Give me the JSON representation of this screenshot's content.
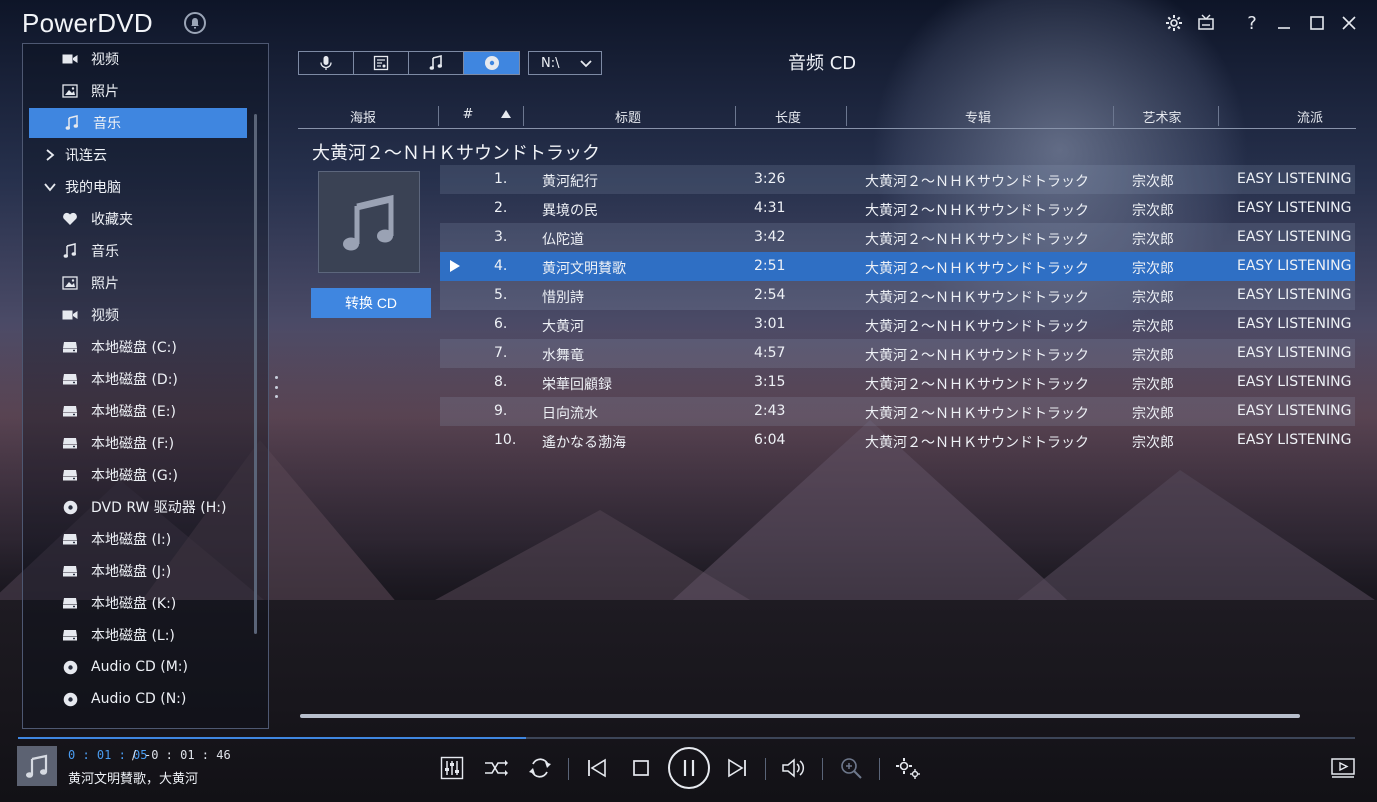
{
  "app": {
    "title": "PowerDVD"
  },
  "window_controls": [
    "settings-icon",
    "tv-mode-icon",
    "help-icon",
    "minimize-icon",
    "maximize-icon",
    "close-icon"
  ],
  "help_label": "?",
  "sidebar": {
    "items": [
      {
        "label": "视频",
        "icon": "video-icon",
        "level": 2
      },
      {
        "label": "照片",
        "icon": "photo-icon",
        "level": 2
      },
      {
        "label": "音乐",
        "icon": "music-icon",
        "level": 2,
        "selected": true
      },
      {
        "label": "讯连云",
        "icon": "chevron-right-icon",
        "level": 1
      },
      {
        "label": "我的电脑",
        "icon": "chevron-down-icon",
        "level": 1
      },
      {
        "label": "收藏夹",
        "icon": "heart-icon",
        "level": 2
      },
      {
        "label": "音乐",
        "icon": "music-icon",
        "level": 2
      },
      {
        "label": "照片",
        "icon": "photo-icon",
        "level": 2
      },
      {
        "label": "视频",
        "icon": "video-icon",
        "level": 2
      },
      {
        "label": "本地磁盘 (C:)",
        "icon": "drive-icon",
        "level": 2
      },
      {
        "label": "本地磁盘 (D:)",
        "icon": "drive-icon",
        "level": 2
      },
      {
        "label": "本地磁盘 (E:)",
        "icon": "drive-icon",
        "level": 2
      },
      {
        "label": "本地磁盘 (F:)",
        "icon": "drive-icon",
        "level": 2
      },
      {
        "label": "本地磁盘 (G:)",
        "icon": "drive-icon",
        "level": 2
      },
      {
        "label": "DVD RW 驱动器 (H:)",
        "icon": "disc-icon",
        "level": 2
      },
      {
        "label": "本地磁盘 (I:)",
        "icon": "drive-icon",
        "level": 2
      },
      {
        "label": "本地磁盘 (J:)",
        "icon": "drive-icon",
        "level": 2
      },
      {
        "label": "本地磁盘 (K:)",
        "icon": "drive-icon",
        "level": 2
      },
      {
        "label": "本地磁盘 (L:)",
        "icon": "drive-icon",
        "level": 2
      },
      {
        "label": "Audio CD (M:)",
        "icon": "disc-icon",
        "level": 2
      },
      {
        "label": "Audio CD (N:)",
        "icon": "disc-icon",
        "level": 2
      }
    ]
  },
  "mode_bar": {
    "buttons": [
      {
        "icon": "microphone-icon"
      },
      {
        "icon": "lyrics-icon"
      },
      {
        "icon": "music-note-icon"
      },
      {
        "icon": "cd-icon",
        "active": true
      }
    ],
    "drive": "N:\\"
  },
  "page_title": "音频 CD",
  "table": {
    "columns": [
      "海报",
      "#",
      "标题",
      "长度",
      "专辑",
      "艺术家",
      "流派"
    ],
    "sort_icon": "sort-ascending-icon"
  },
  "album": {
    "title": "大黄河２～ＮＨＫサウンドトラック",
    "convert_label": "转换 CD"
  },
  "tracks": [
    {
      "num": "1.",
      "title": "黄河紀行",
      "length": "3:26",
      "album": "大黄河２～ＮＨＫサウンドトラック",
      "artist": "宗次郎",
      "genre": "EASY LISTENING"
    },
    {
      "num": "2.",
      "title": "異境の民",
      "length": "4:31",
      "album": "大黄河２～ＮＨＫサウンドトラック",
      "artist": "宗次郎",
      "genre": "EASY LISTENING"
    },
    {
      "num": "3.",
      "title": "仏陀道",
      "length": "3:42",
      "album": "大黄河２～ＮＨＫサウンドトラック",
      "artist": "宗次郎",
      "genre": "EASY LISTENING"
    },
    {
      "num": "4.",
      "title": "黄河文明賛歌",
      "length": "2:51",
      "album": "大黄河２～ＮＨＫサウンドトラック",
      "artist": "宗次郎",
      "genre": "EASY LISTENING",
      "playing": true
    },
    {
      "num": "5.",
      "title": "惜別詩",
      "length": "2:54",
      "album": "大黄河２～ＮＨＫサウンドトラック",
      "artist": "宗次郎",
      "genre": "EASY LISTENING"
    },
    {
      "num": "6.",
      "title": "大黄河",
      "length": "3:01",
      "album": "大黄河２～ＮＨＫサウンドトラック",
      "artist": "宗次郎",
      "genre": "EASY LISTENING"
    },
    {
      "num": "7.",
      "title": "水舞竜",
      "length": "4:57",
      "album": "大黄河２～ＮＨＫサウンドトラック",
      "artist": "宗次郎",
      "genre": "EASY LISTENING"
    },
    {
      "num": "8.",
      "title": "栄華回顧録",
      "length": "3:15",
      "album": "大黄河２～ＮＨＫサウンドトラック",
      "artist": "宗次郎",
      "genre": "EASY LISTENING"
    },
    {
      "num": "9.",
      "title": "日向流水",
      "length": "2:43",
      "album": "大黄河２～ＮＨＫサウンドトラック",
      "artist": "宗次郎",
      "genre": "EASY LISTENING"
    },
    {
      "num": "10.",
      "title": "遙かなる渤海",
      "length": "6:04",
      "album": "大黄河２～ＮＨＫサウンドトラック",
      "artist": "宗次郎",
      "genre": "EASY LISTENING"
    }
  ],
  "player": {
    "elapsed": "0 : 01 : 05",
    "separator": "/",
    "remaining": "-0 : 01 : 46",
    "now_playing": "黄河文明賛歌，大黄河",
    "progress_fraction": 0.38,
    "controls": [
      "equalizer-icon",
      "shuffle-icon",
      "repeat-icon",
      "previous-icon",
      "stop-icon",
      "pause-icon",
      "next-icon",
      "volume-icon",
      "zoom-icon",
      "settings-gear-icon",
      "mini-player-icon"
    ]
  },
  "colors": {
    "accent": "#3f86e0",
    "playing_row": "#2f6fc4",
    "time_text": "#4a9cf0"
  }
}
